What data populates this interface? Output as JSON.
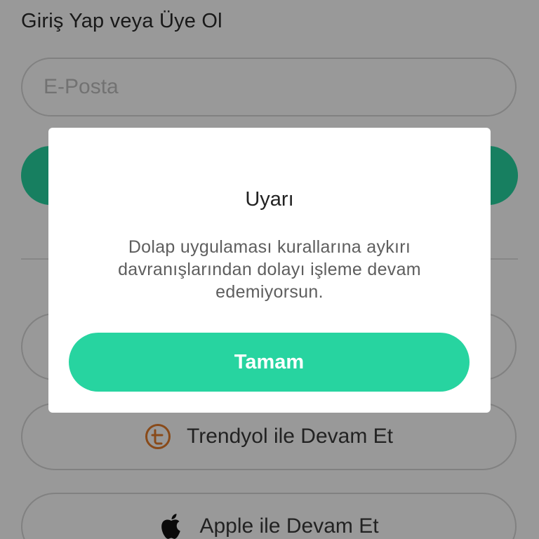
{
  "login": {
    "heading": "Giriş Yap veya Üye Ol",
    "email_placeholder": "E-Posta"
  },
  "social": {
    "trendyol_label": "Trendyol ile Devam Et",
    "apple_label": "Apple ile Devam Et"
  },
  "dialog": {
    "title": "Uyarı",
    "message": "Dolap uygulaması kurallarına aykırı davranışlarından dolayı işleme devam edemiyorsun.",
    "ok_label": "Tamam"
  },
  "colors": {
    "accent": "#27d4a0",
    "trendyol_icon": "#e47c2a",
    "overlay": "rgba(0,0,0,0.40)"
  },
  "icons": {
    "trendyol": "trendyol-logo-icon",
    "apple": "apple-logo-icon"
  }
}
